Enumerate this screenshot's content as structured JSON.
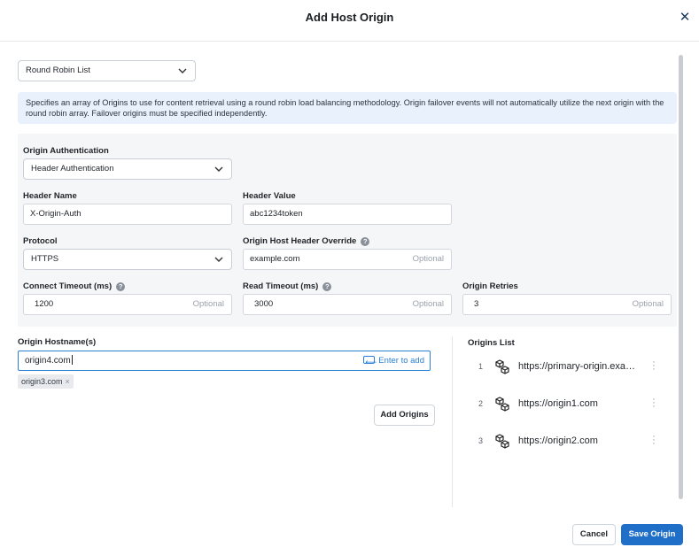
{
  "dialog": {
    "title": "Add Host Origin",
    "close_icon": "close-icon"
  },
  "load_balancing": {
    "selected": "Round Robin List"
  },
  "info_text": "Specifies an array of Origins to use for content retrieval using a round robin load balancing methodology. Origin failover events will not automatically utilize the next origin with the round robin array. Failover origins must be specified independently.",
  "auth": {
    "label": "Origin Authentication",
    "selected": "Header Authentication"
  },
  "header_name": {
    "label": "Header Name",
    "value": "X-Origin-Auth"
  },
  "header_value": {
    "label": "Header Value",
    "value": "abc1234token"
  },
  "protocol": {
    "label": "Protocol",
    "selected": "HTTPS"
  },
  "host_header_override": {
    "label": "Origin Host Header Override",
    "value": "example.com",
    "optional": "Optional"
  },
  "connect_timeout": {
    "label": "Connect Timeout (ms)",
    "value": "1200",
    "optional": "Optional"
  },
  "read_timeout": {
    "label": "Read Timeout (ms)",
    "value": "3000",
    "optional": "Optional"
  },
  "origin_retries": {
    "label": "Origin Retries",
    "value": "3",
    "optional": "Optional"
  },
  "hostnames": {
    "label": "Origin Hostname(s)",
    "input_value": "origin4.com",
    "enter_hint": "Enter to add",
    "chips": [
      "origin3.com"
    ],
    "add_button": "Add Origins"
  },
  "origins_list": {
    "title": "Origins List",
    "items": [
      {
        "index": "1",
        "url": "https://primary-origin.example.com"
      },
      {
        "index": "2",
        "url": "https://origin1.com"
      },
      {
        "index": "3",
        "url": "https://origin2.com"
      }
    ]
  },
  "footer": {
    "cancel_label": "Cancel",
    "save_label": "Save Origin"
  },
  "colors": {
    "accent": "#1f6fc8",
    "focus_border": "#2a7fd4",
    "info_bg": "#e8f1fc",
    "panel_bg": "#f5f6f7"
  }
}
